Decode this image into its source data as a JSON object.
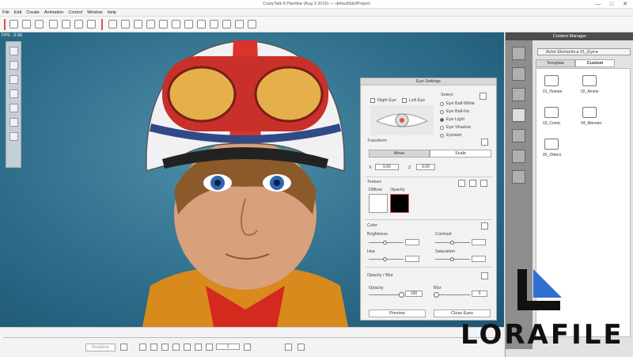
{
  "window": {
    "title": "CrazyTalk 8 Pipeline (Aug 3 2016) — default3dctProject",
    "min_label": "—",
    "max_label": "□",
    "close_label": "✕"
  },
  "menu": [
    "File",
    "Edit",
    "Create",
    "Animation",
    "Control",
    "Window",
    "Help"
  ],
  "viewport": {
    "fps": "FPS : 0.00"
  },
  "eye_settings": {
    "title": "Eye Settings",
    "right_eye": "Right Eye",
    "left_eye": "Left Eye",
    "select_label": "Select",
    "options": [
      "Eye Ball-White",
      "Eye Ball-Iris",
      "Eye Light",
      "Eye Shadow",
      "Eyelash"
    ],
    "selected_option": "Eye Light",
    "transform_label": "Transform",
    "move_tab": "Move",
    "scale_tab": "Scale",
    "x_label": "X",
    "x_value": "0.00",
    "z_label": "Z",
    "z_value": "0.00",
    "texture_label": "Texture",
    "diffuse_label": "Diffuse",
    "opacity_label": "Opacity",
    "color_label": "Color",
    "brightness_label": "Brightness",
    "contrast_label": "Contrast",
    "hue_label": "Hue",
    "saturation_label": "Saturation",
    "opacity_blur_label": "Opacity / Blur",
    "opacity_slider_label": "Opacity",
    "opacity_value": "100",
    "blur_label": "Blur",
    "blur_value": "0",
    "preview_button": "Preview",
    "close_eyes_button": "Close Eyes"
  },
  "content_manager": {
    "title": "Content Manager",
    "breadcrumb": "Actor Elements ▸ 01_Eye ▸",
    "tab_template": "Template",
    "tab_custom": "Custom",
    "items": [
      "01_Human",
      "02_Anime",
      "03_Comic",
      "04_Monster",
      "05_Others"
    ]
  },
  "timeline": {
    "realtime_label": "Realtime",
    "frame_value": "1"
  },
  "watermark": {
    "text": "LORAFILE"
  },
  "colors": {
    "accent": "#e05050",
    "background": "#2f6f8c"
  }
}
